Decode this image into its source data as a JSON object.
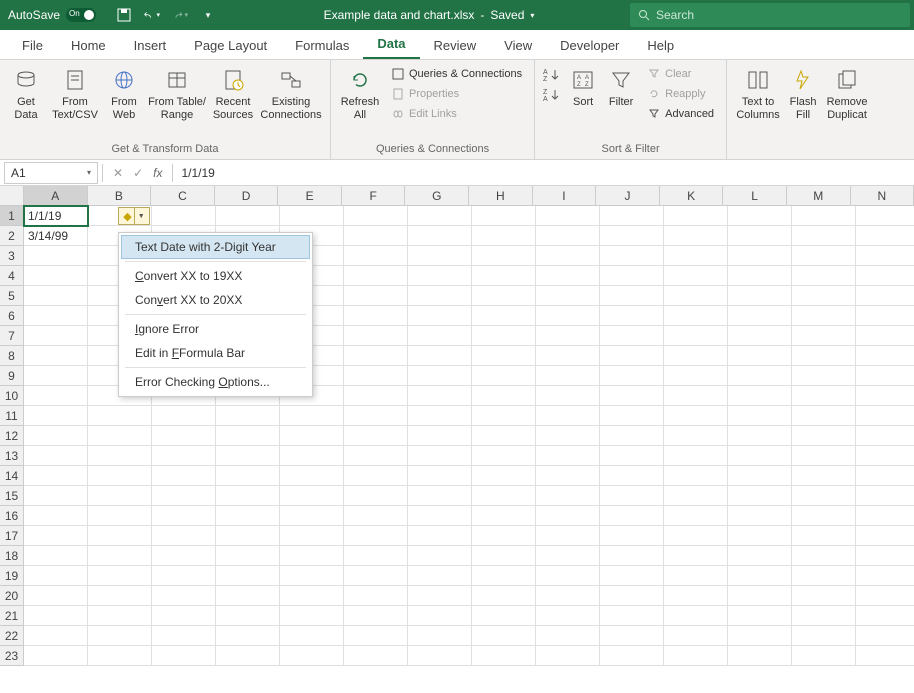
{
  "titlebar": {
    "autosave_label": "AutoSave",
    "autosave_state": "On",
    "filename": "Example data and chart.xlsx",
    "saved_status": "Saved",
    "search_placeholder": "Search"
  },
  "tabs": {
    "items": [
      "File",
      "Home",
      "Insert",
      "Page Layout",
      "Formulas",
      "Data",
      "Review",
      "View",
      "Developer",
      "Help"
    ],
    "active": "Data"
  },
  "ribbon": {
    "group_get_transform": {
      "label": "Get & Transform Data",
      "get_data": "Get\nData",
      "from_text": "From\nText/CSV",
      "from_web": "From\nWeb",
      "from_table": "From Table/\nRange",
      "recent": "Recent\nSources",
      "existing": "Existing\nConnections"
    },
    "group_queries": {
      "label": "Queries & Connections",
      "refresh": "Refresh\nAll",
      "queries_conn": "Queries & Connections",
      "properties": "Properties",
      "edit_links": "Edit Links"
    },
    "group_sort": {
      "label": "Sort & Filter",
      "sort": "Sort",
      "filter": "Filter",
      "clear": "Clear",
      "reapply": "Reapply",
      "advanced": "Advanced"
    },
    "group_tools": {
      "text_cols": "Text to\nColumns",
      "flash_fill": "Flash\nFill",
      "remove_dup": "Remove\nDuplicat"
    }
  },
  "formula_bar": {
    "name_box": "A1",
    "formula": "1/1/19"
  },
  "grid": {
    "columns": [
      "A",
      "B",
      "C",
      "D",
      "E",
      "F",
      "G",
      "H",
      "I",
      "J",
      "K",
      "L",
      "M",
      "N"
    ],
    "rows": 23,
    "selected_cell": "A1",
    "cells": {
      "A1": "1/1/19",
      "A2": "3/14/99"
    }
  },
  "context_menu": {
    "title": "Text Date with 2-Digit Year",
    "convert_19": "Convert XX to 19XX",
    "convert_20": "Convert XX to 20XX",
    "ignore": "Ignore Error",
    "edit_fb": "Edit in Formula Bar",
    "options": "Error Checking Options..."
  }
}
